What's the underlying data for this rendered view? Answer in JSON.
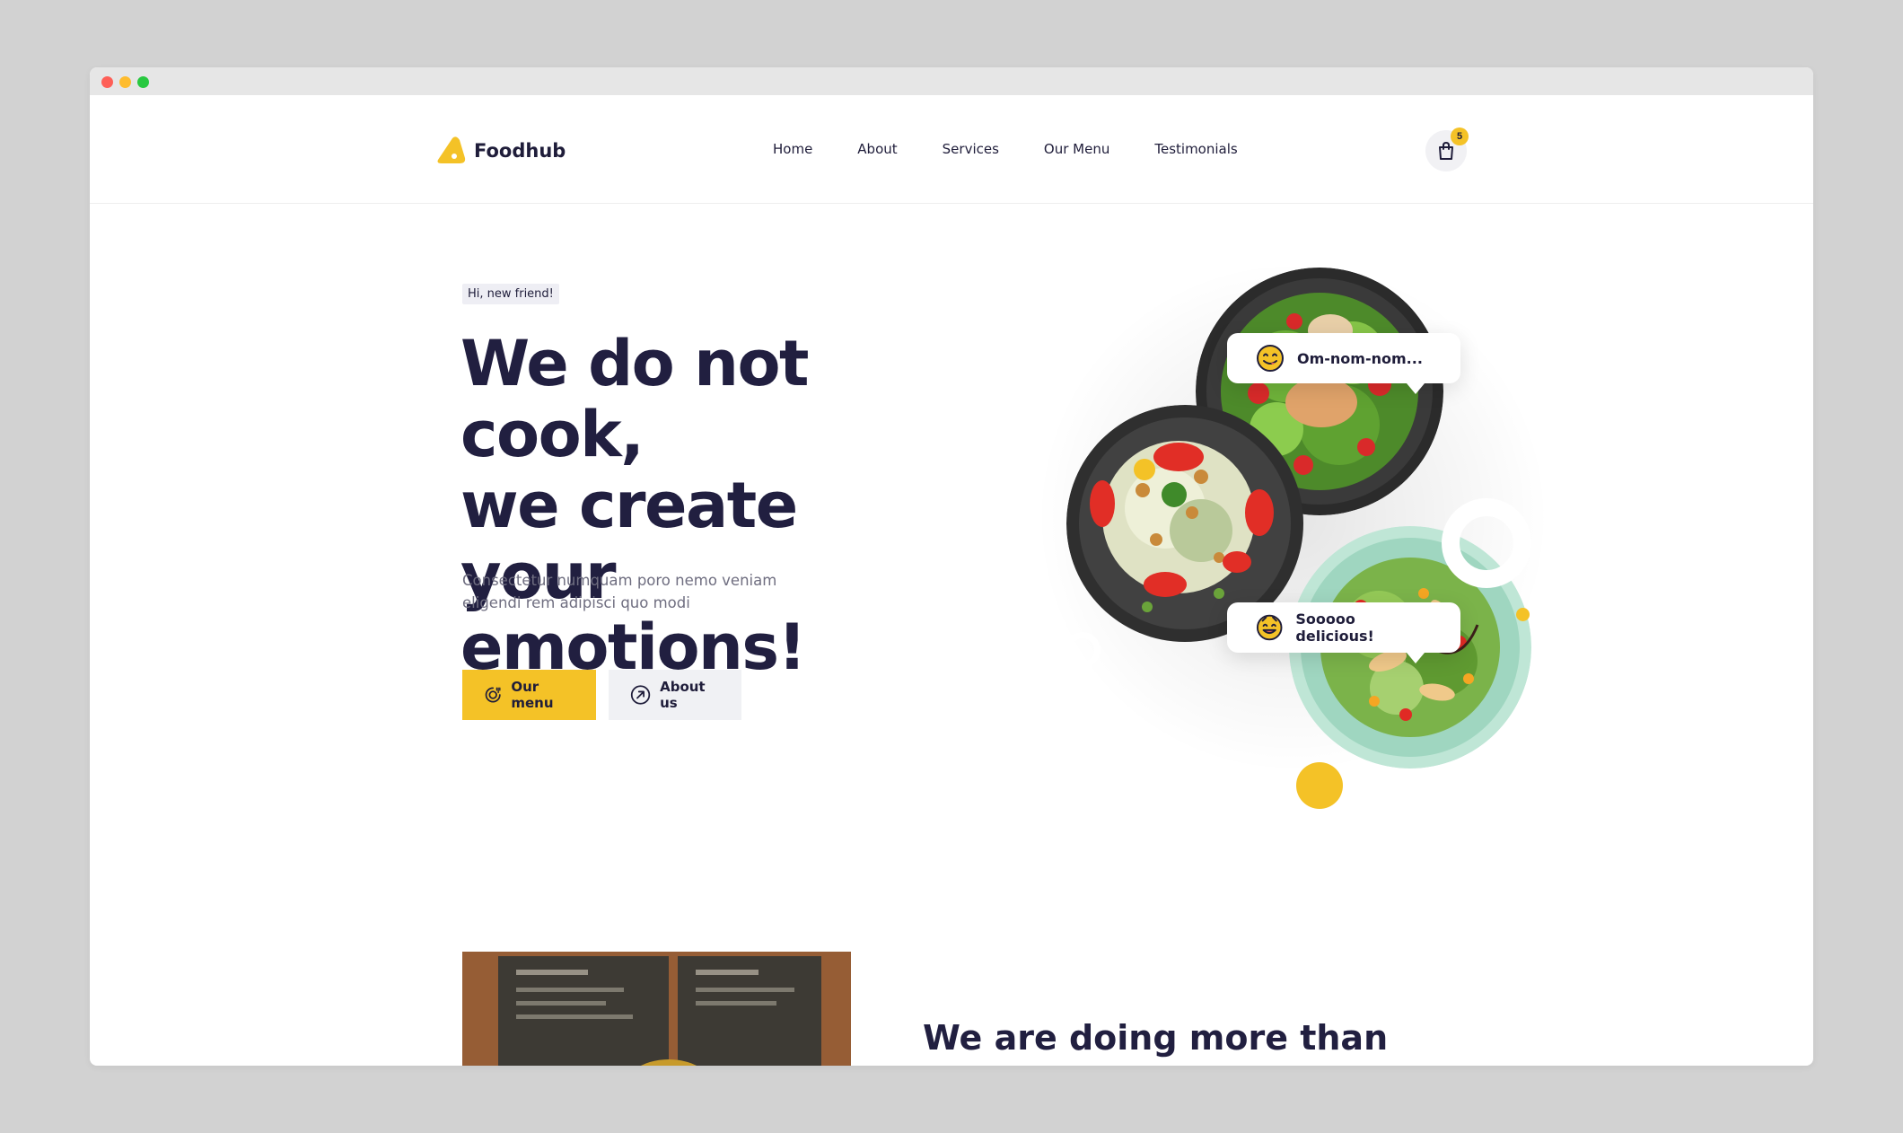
{
  "brand": {
    "name": "Foodhub",
    "accent": "#f4c227",
    "ink": "#211f40"
  },
  "nav": [
    {
      "label": "Home"
    },
    {
      "label": "About"
    },
    {
      "label": "Services"
    },
    {
      "label": "Our Menu"
    },
    {
      "label": "Testimonials"
    }
  ],
  "cart": {
    "count": "5",
    "icon": "shopping-bag-icon"
  },
  "hero": {
    "tag": "Hi, new friend!",
    "title_line1": "We do not cook,",
    "title_line2": "we create your",
    "title_line3": "emotions!",
    "description": "Consectetur numquam poro nemo veniam eligendi rem adipisci quo modi",
    "primary_button": "Our menu",
    "secondary_button": "About us"
  },
  "bubbles": [
    {
      "text": "Om-nom-nom...",
      "icon": "yum-face-icon"
    },
    {
      "text": "Sooooo delicious!",
      "icon": "smiling-face-icon"
    }
  ],
  "section2": {
    "title": "We are doing more than"
  }
}
